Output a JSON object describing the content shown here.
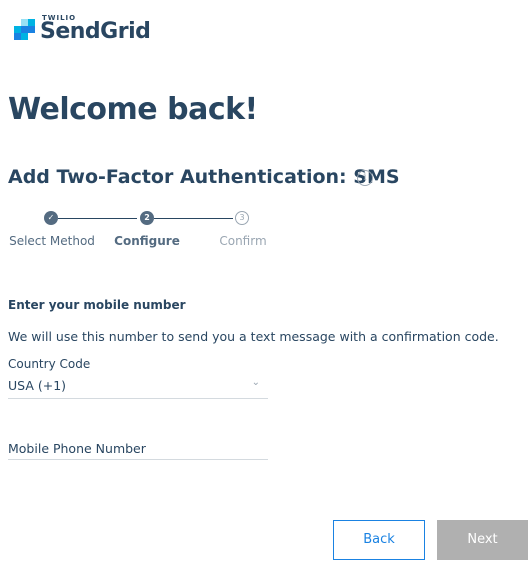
{
  "logo": {
    "brand_small": "TWILIO",
    "brand": "SendGrid",
    "colors": [
      "#1a82e2",
      "#00b3e3",
      "#294661"
    ]
  },
  "heading": "Welcome back!",
  "subtitle": "Add Two-Factor Authentication: SMS",
  "info_icon": "info-icon",
  "stepper": {
    "steps": [
      {
        "label": "Select Method",
        "state": "done",
        "marker": "✓"
      },
      {
        "label": "Configure",
        "state": "active",
        "marker": "2"
      },
      {
        "label": "Confirm",
        "state": "pending",
        "marker": "3"
      }
    ]
  },
  "form": {
    "section_title": "Enter your mobile number",
    "description": "We will use this number to send you a text message with a confirmation code.",
    "country_code": {
      "label": "Country Code",
      "value": "USA (+1)",
      "icon": "chevron-down-icon"
    },
    "phone": {
      "placeholder": "Mobile Phone Number",
      "value": ""
    }
  },
  "buttons": {
    "back": "Back",
    "next": "Next"
  },
  "colors": {
    "text": "#294661",
    "accent": "#1a82e2",
    "disabled": "#b0b0b0",
    "muted": "#9aa6b2"
  }
}
